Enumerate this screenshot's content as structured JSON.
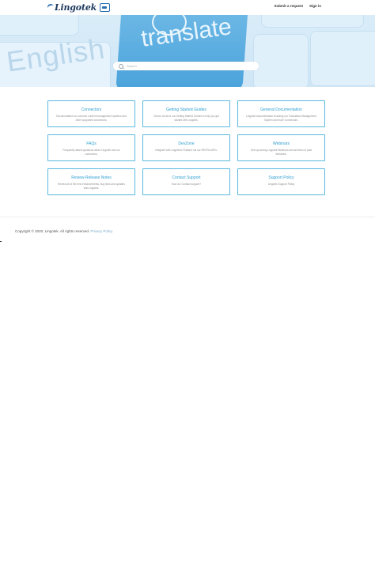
{
  "header": {
    "logo_text": "Lingotek",
    "nav": {
      "submit_request": "Submit a request",
      "sign_in": "Sign in"
    }
  },
  "hero": {
    "word_left": "English",
    "word_key": "translate",
    "search_placeholder": "Search"
  },
  "cards": [
    {
      "title": "Connectors",
      "desc": "Documentation for common content management systems and other supported connectors."
    },
    {
      "title": "Getting Started Guides",
      "desc": "Check out all of our Getting Started Guides to help you get started with Lingotek."
    },
    {
      "title": "General Documentation",
      "desc": "Lingotek documentation including our Translation Management System and more Connectors."
    },
    {
      "title": "FAQs",
      "desc": "Frequently asked questions about Lingotek and our connectors."
    },
    {
      "title": "DevZone",
      "desc": "Integrate with Lingotek's Platform via our RESTful APIs."
    },
    {
      "title": "Webinars",
      "desc": "See upcoming Lingotek Webinars and archives of past Webinars."
    },
    {
      "title": "Review Release Notes",
      "desc": "Review all of the new enhancements, bug fixes and updates with Lingotek."
    },
    {
      "title": "Contact Support",
      "desc": "How do I contact support?"
    },
    {
      "title": "Support Policy",
      "desc": "Lingotek Support Policy"
    }
  ],
  "footer": {
    "copyright": "Copyright © 2020, Lingotek. All rights reserved.",
    "privacy_link": "Privacy Policy"
  },
  "colors": {
    "accent": "#2e9fd1",
    "card_border": "#5ab8de",
    "hero_bg": "#d9ecf8",
    "key_blue": "#4aa3db"
  }
}
